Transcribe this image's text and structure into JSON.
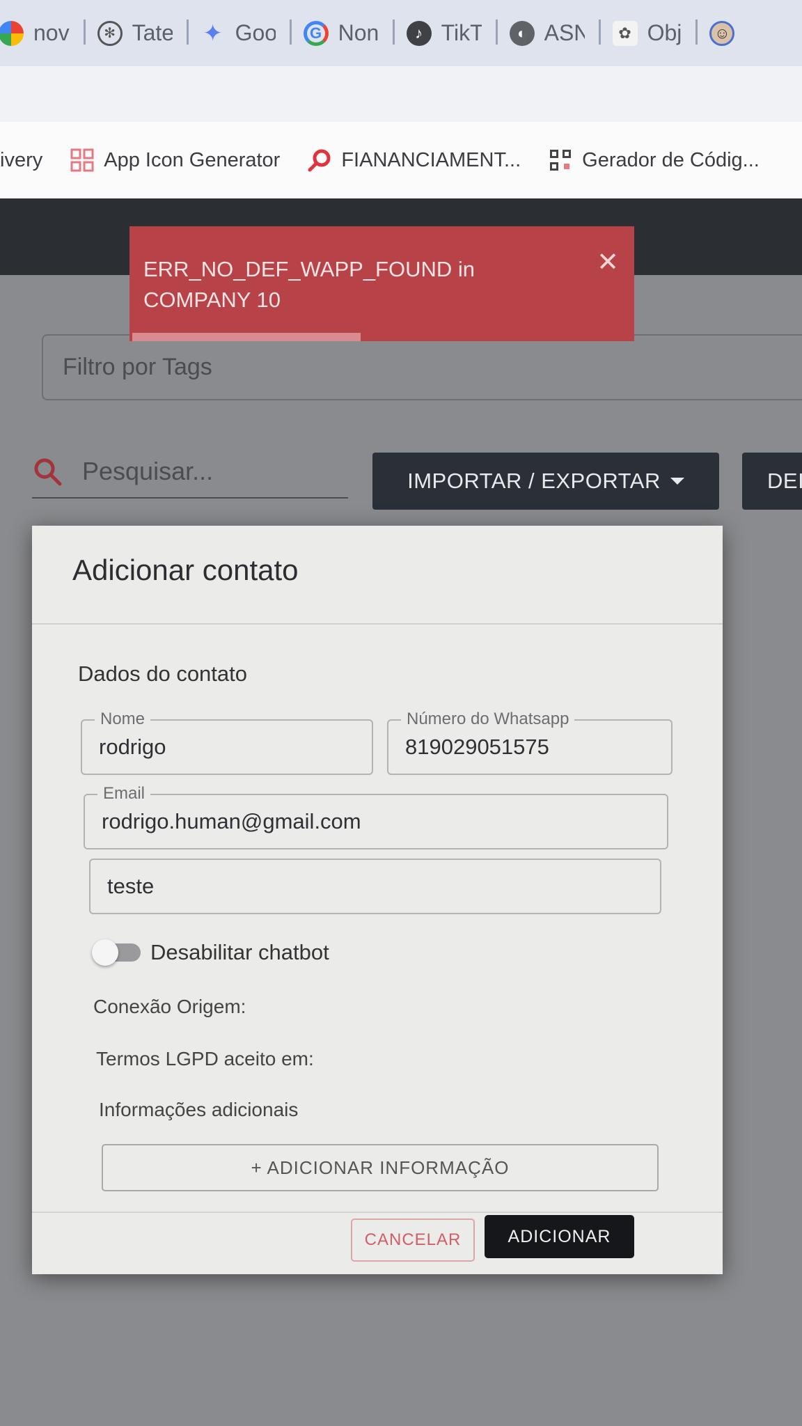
{
  "browser": {
    "tabs": [
      {
        "label": "nov",
        "icon": "browser-favicon-icon"
      },
      {
        "label": "Tate",
        "icon": "openai-icon"
      },
      {
        "label": "Goo",
        "icon": "gemini-sparkle-icon"
      },
      {
        "label": "Non",
        "icon": "google-icon"
      },
      {
        "label": "TikT",
        "icon": "tiktok-icon"
      },
      {
        "label": "ASN",
        "icon": "globe-icon"
      },
      {
        "label": "Obj",
        "icon": "object-app-icon"
      }
    ],
    "bookmarks": [
      {
        "label": "ivery",
        "icon": ""
      },
      {
        "label": "App Icon Generator",
        "icon": "grid-icon"
      },
      {
        "label": "FIANANCIAMENT...",
        "icon": "search-icon"
      },
      {
        "label": "Gerador de Códig...",
        "icon": "qr-code-icon"
      }
    ]
  },
  "toast": {
    "message": "ERR_NO_DEF_WAPP_FOUND in COMPANY 10",
    "close": "✕"
  },
  "page": {
    "tag_filter_placeholder": "Filtro por Tags",
    "search_placeholder": "Pesquisar...",
    "import_export_label": "IMPORTAR / EXPORTAR",
    "partial_button_label": "DEI"
  },
  "dialog": {
    "title": "Adicionar contato",
    "section_title": "Dados do contato",
    "name_label": "Nome",
    "name_value": "rodrigo",
    "whatsapp_label": "Número do Whatsapp",
    "whatsapp_value": "819029051575",
    "email_label": "Email",
    "email_value": "rodrigo.human@gmail.com",
    "extra_value": "teste",
    "disable_chatbot_label": "Desabilitar chatbot",
    "connection_origin_label": "Conexão Origem:",
    "lgpd_terms_label": "Termos LGPD aceito em:",
    "additional_info_label": "Informações adicionais",
    "add_info_button": "+ ADICIONAR INFORMAÇÃO",
    "cancel_button": "CANCELAR",
    "add_button": "ADICIONAR"
  },
  "colors": {
    "toast_bg": "#b74348",
    "dark_button": "#2b2f37",
    "cancel_accent": "#d15f66"
  }
}
